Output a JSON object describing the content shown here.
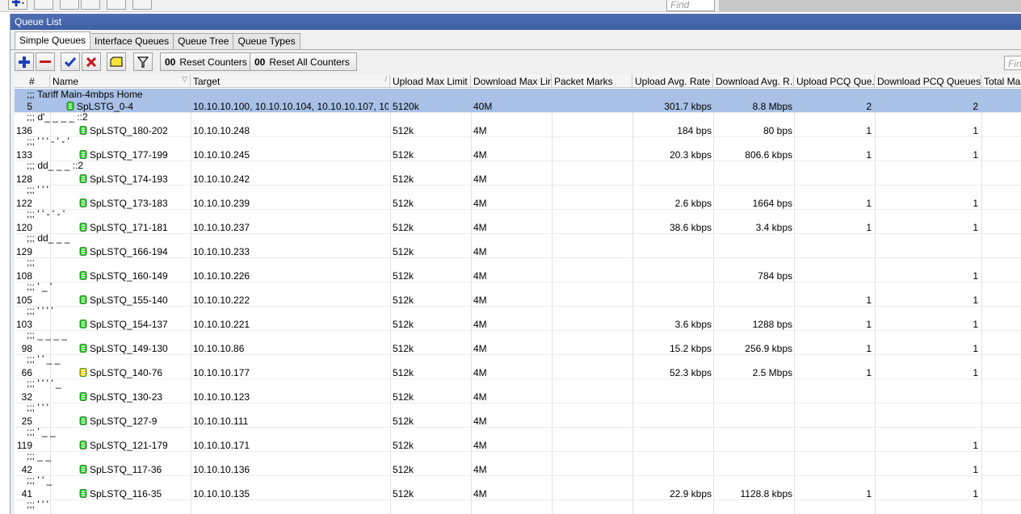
{
  "top": {
    "find_placeholder": "Find"
  },
  "window": {
    "title": "Queue List"
  },
  "tabs": [
    {
      "label": "Simple Queues",
      "active": true
    },
    {
      "label": "Interface Queues",
      "active": false
    },
    {
      "label": "Queue Tree",
      "active": false
    },
    {
      "label": "Queue Types",
      "active": false
    }
  ],
  "toolbar": {
    "reset_counters": "Reset Counters",
    "reset_all_counters": "Reset All Counters",
    "oo": "00",
    "find_placeholder": "Find"
  },
  "columns": [
    "#",
    "Name",
    "Target",
    "Upload Max Limit",
    "Download Max Limit",
    "Packet Marks",
    "Upload Avg. Rate",
    "Download Avg. R...",
    "Upload PCQ Que...",
    "Download PCQ Queues",
    "Total Ma"
  ],
  "group_comment": ";;; Tariff Main-4mbps Home",
  "colors": {
    "selection": "#a9c1e6",
    "icon_green": "#2bd12b",
    "icon_yellow": "#f0d000",
    "titlebar": "#4e6eb0"
  },
  "rows": [
    {
      "num": "5",
      "name": "SpLSTG_0-4",
      "target": "10.10.10.100, 10.10.10.104, 10.10.10.107, 10.1...",
      "up": "5120k",
      "down": "40M",
      "up_rate": "301.7 kbps",
      "down_rate": "8.8 Mbps",
      "up_pcq": "2",
      "down_pcq": "2",
      "icon": "green",
      "selected": true,
      "comment_after": ";;; d'_ _ _ _ ::2"
    },
    {
      "num": "136",
      "name": "SpLSTQ_180-202",
      "target": "10.10.10.248",
      "up": "512k",
      "down": "4M",
      "up_rate": "184 bps",
      "down_rate": "80 bps",
      "up_pcq": "1",
      "down_pcq": "1",
      "icon": "green",
      "comment_after": ";;; ' ' ' - ' - '"
    },
    {
      "num": "133",
      "name": "SpLSTQ_177-199",
      "target": "10.10.10.245",
      "up": "512k",
      "down": "4M",
      "up_rate": "20.3 kbps",
      "down_rate": "806.6 kbps",
      "up_pcq": "1",
      "down_pcq": "1",
      "icon": "green",
      "comment_after": ";;; dd_ _ _ ::2"
    },
    {
      "num": "128",
      "name": "SpLSTQ_174-193",
      "target": "10.10.10.242",
      "up": "512k",
      "down": "4M",
      "up_rate": "",
      "down_rate": "",
      "up_pcq": "",
      "down_pcq": "",
      "icon": "green",
      "comment_after": ";;; ' ' '"
    },
    {
      "num": "122",
      "name": "SpLSTQ_173-183",
      "target": "10.10.10.239",
      "up": "512k",
      "down": "4M",
      "up_rate": "2.6 kbps",
      "down_rate": "1664 bps",
      "up_pcq": "1",
      "down_pcq": "1",
      "icon": "green",
      "comment_after": ";;; ' ' - ' - '"
    },
    {
      "num": "120",
      "name": "SpLSTQ_171-181",
      "target": "10.10.10.237",
      "up": "512k",
      "down": "4M",
      "up_rate": "38.6 kbps",
      "down_rate": "3.4 kbps",
      "up_pcq": "1",
      "down_pcq": "1",
      "icon": "green",
      "comment_after": ";;; dd_ _ _"
    },
    {
      "num": "129",
      "name": "SpLSTQ_166-194",
      "target": "10.10.10.233",
      "up": "512k",
      "down": "4M",
      "up_rate": "",
      "down_rate": "",
      "up_pcq": "",
      "down_pcq": "",
      "icon": "green",
      "comment_after": ";;;"
    },
    {
      "num": "108",
      "name": "SpLSTQ_160-149",
      "target": "10.10.10.226",
      "up": "512k",
      "down": "4M",
      "up_rate": "",
      "down_rate": "784 bps",
      "up_pcq": "",
      "down_pcq": "1",
      "icon": "green",
      "comment_after": ";;; ' _ '"
    },
    {
      "num": "105",
      "name": "SpLSTQ_155-140",
      "target": "10.10.10.222",
      "up": "512k",
      "down": "4M",
      "up_rate": "",
      "down_rate": "",
      "up_pcq": "1",
      "down_pcq": "1",
      "icon": "green",
      "comment_after": ";;; ' ' ' '"
    },
    {
      "num": "103",
      "name": "SpLSTQ_154-137",
      "target": "10.10.10.221",
      "up": "512k",
      "down": "4M",
      "up_rate": "3.6 kbps",
      "down_rate": "1288 bps",
      "up_pcq": "1",
      "down_pcq": "1",
      "icon": "green",
      "comment_after": ";;; _ _ _ _"
    },
    {
      "num": "98",
      "name": "SpLSTQ_149-130",
      "target": "10.10.10.86",
      "up": "512k",
      "down": "4M",
      "up_rate": "15.2 kbps",
      "down_rate": "256.9 kbps",
      "up_pcq": "1",
      "down_pcq": "1",
      "icon": "green",
      "comment_after": ";;; ' ' _ _"
    },
    {
      "num": "66",
      "name": "SpLSTQ_140-76",
      "target": "10.10.10.177",
      "up": "512k",
      "down": "4M",
      "up_rate": "52.3 kbps",
      "down_rate": "2.5 Mbps",
      "up_pcq": "1",
      "down_pcq": "1",
      "icon": "yellow",
      "comment_after": ";;; ' ' ' ' _"
    },
    {
      "num": "32",
      "name": "SpLSTQ_130-23",
      "target": "10.10.10.123",
      "up": "512k",
      "down": "4M",
      "up_rate": "",
      "down_rate": "",
      "up_pcq": "",
      "down_pcq": "",
      "icon": "green",
      "comment_after": ";;; ' ' '"
    },
    {
      "num": "25",
      "name": "SpLSTQ_127-9",
      "target": "10.10.10.111",
      "up": "512k",
      "down": "4M",
      "up_rate": "",
      "down_rate": "",
      "up_pcq": "",
      "down_pcq": "",
      "icon": "green",
      "comment_after": ";;; ' _ _"
    },
    {
      "num": "119",
      "name": "SpLSTQ_121-179",
      "target": "10.10.10.171",
      "up": "512k",
      "down": "4M",
      "up_rate": "",
      "down_rate": "",
      "up_pcq": "",
      "down_pcq": "1",
      "icon": "green",
      "comment_after": ";;; _ _"
    },
    {
      "num": "42",
      "name": "SpLSTQ_117-36",
      "target": "10.10.10.136",
      "up": "512k",
      "down": "4M",
      "up_rate": "",
      "down_rate": "",
      "up_pcq": "",
      "down_pcq": "1",
      "icon": "green",
      "comment_after": ";;; ' ' _"
    },
    {
      "num": "41",
      "name": "SpLSTQ_116-35",
      "target": "10.10.10.135",
      "up": "512k",
      "down": "4M",
      "up_rate": "22.9 kbps",
      "down_rate": "1128.8 kbps",
      "up_pcq": "1",
      "down_pcq": "1",
      "icon": "green",
      "comment_after": ";;; ' ' '"
    }
  ]
}
